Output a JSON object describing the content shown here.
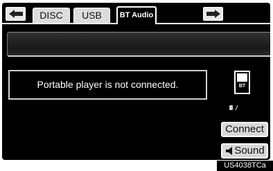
{
  "tabs": [
    {
      "label": "DISC"
    },
    {
      "label": "USB"
    },
    {
      "label": "BT Audio",
      "active": true
    }
  ],
  "nav": {
    "prev_icon": "left-arrow-icon",
    "next_icon": "right-arrow-icon"
  },
  "status": {
    "message": "Portable player is not connected.",
    "device_icon_text": "BT"
  },
  "buttons": {
    "connect_label": "Connect",
    "sound_label": "Sound"
  },
  "figure_code": "US4038TCa",
  "colors": {
    "background": "#000000",
    "button_face": "#d8d8d8",
    "text": "#ffffff"
  }
}
